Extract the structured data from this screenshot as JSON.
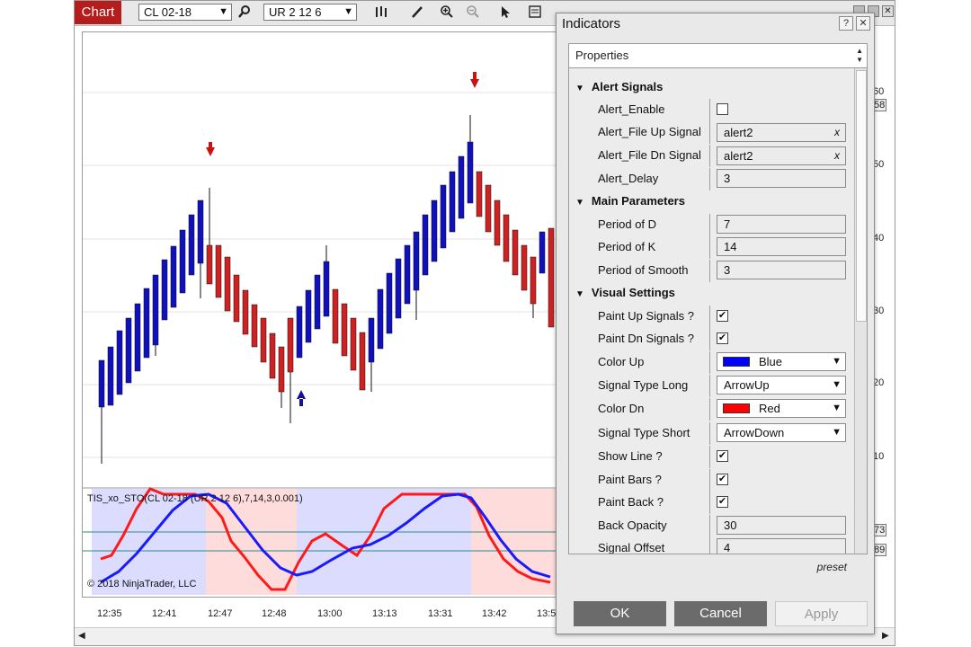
{
  "toolbar": {
    "chart_tab": "Chart",
    "instrument": "CL 02-18",
    "bar_type": "UR 2 12 6"
  },
  "chart": {
    "indicator_label": "TIS_xo_STO(CL 02-18 (UR 2 12 6),7,14,3,0.001)",
    "copyright": "© 2018 NinjaTrader, LLC",
    "price_labels": [
      "60",
      "50",
      "40",
      "30",
      "20",
      "10"
    ],
    "price_box": "58",
    "osc_boxes": [
      "73",
      "89"
    ],
    "time_labels": [
      "12:35",
      "12:41",
      "12:47",
      "12:48",
      "13:00",
      "13:13",
      "13:31",
      "13:42",
      "13:5"
    ]
  },
  "dialog": {
    "title": "Indicators",
    "help": "?",
    "close": "✕",
    "properties_header": "Properties",
    "categories": {
      "alert": "Alert Signals",
      "main": "Main Parameters",
      "visual": "Visual Settings"
    },
    "rows": {
      "alert_enable": {
        "label": "Alert_Enable"
      },
      "alert_file_up": {
        "label": "Alert_File Up Signal",
        "value": "alert2"
      },
      "alert_file_dn": {
        "label": "Alert_File Dn Signal",
        "value": "alert2"
      },
      "alert_delay": {
        "label": "Alert_Delay",
        "value": "3"
      },
      "period_d": {
        "label": "Period of D",
        "value": "7"
      },
      "period_k": {
        "label": "Period of K",
        "value": "14"
      },
      "period_smooth": {
        "label": "Period of Smooth",
        "value": "3"
      },
      "paint_up": {
        "label": "Paint Up Signals ?"
      },
      "paint_dn": {
        "label": "Paint Dn Signals ?"
      },
      "color_up": {
        "label": "Color Up",
        "value": "Blue",
        "swatch": "#0000ff"
      },
      "signal_long": {
        "label": "Signal Type Long",
        "value": "ArrowUp"
      },
      "color_dn": {
        "label": "Color Dn",
        "value": "Red",
        "swatch": "#ff0000"
      },
      "signal_short": {
        "label": "Signal Type Short",
        "value": "ArrowDown"
      },
      "show_line": {
        "label": "Show Line ?"
      },
      "paint_bars": {
        "label": "Paint Bars ?"
      },
      "paint_back": {
        "label": "Paint Back ?"
      },
      "back_opacity": {
        "label": "Back Opacity",
        "value": "30"
      },
      "signal_offset": {
        "label": "Signal Offset",
        "value": "4"
      }
    },
    "preset": "preset",
    "ok": "OK",
    "cancel": "Cancel",
    "apply": "Apply"
  },
  "colors": {
    "up_bar": "#1111bb",
    "down_bar": "#cc2222",
    "stoch_k": "#ff1a1a",
    "stoch_d": "#1a1aff",
    "back_up": "#dcdcff",
    "back_dn": "#ffdcdc"
  }
}
